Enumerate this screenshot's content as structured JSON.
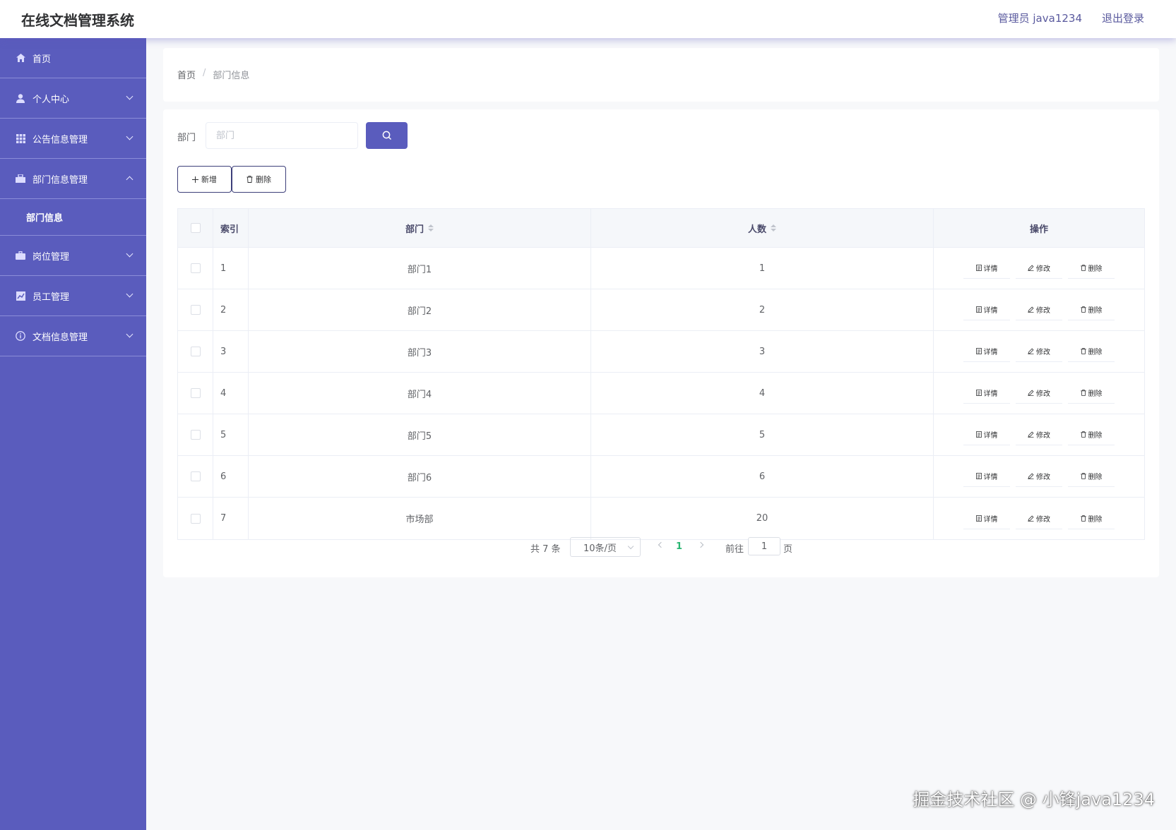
{
  "header": {
    "title": "在线文档管理系统",
    "user": "管理员 java1234",
    "logout": "退出登录"
  },
  "sidebar": {
    "items": [
      {
        "label": "首页",
        "icon": "home-icon"
      },
      {
        "label": "个人中心",
        "icon": "user-icon"
      },
      {
        "label": "公告信息管理",
        "icon": "grid-icon"
      },
      {
        "label": "部门信息管理",
        "icon": "briefcase-icon"
      },
      {
        "label": "岗位管理",
        "icon": "suitcase-icon"
      },
      {
        "label": "员工管理",
        "icon": "chart-icon"
      },
      {
        "label": "文档信息管理",
        "icon": "info-icon"
      }
    ],
    "submenu": {
      "label": "部门信息"
    }
  },
  "breadcrumb": {
    "home": "首页",
    "separator": "/",
    "current": "部门信息"
  },
  "search": {
    "label": "部门",
    "placeholder": "部门",
    "value": ""
  },
  "toolbar": {
    "add_label": "新增",
    "delete_label": "删除"
  },
  "table": {
    "headers": {
      "index": "索引",
      "department": "部门",
      "count": "人数",
      "actions": "操作"
    },
    "rows": [
      {
        "index": "1",
        "department": "部门1",
        "count": "1"
      },
      {
        "index": "2",
        "department": "部门2",
        "count": "2"
      },
      {
        "index": "3",
        "department": "部门3",
        "count": "3"
      },
      {
        "index": "4",
        "department": "部门4",
        "count": "4"
      },
      {
        "index": "5",
        "department": "部门5",
        "count": "5"
      },
      {
        "index": "6",
        "department": "部门6",
        "count": "6"
      },
      {
        "index": "7",
        "department": "市场部",
        "count": "20"
      }
    ],
    "actions": {
      "detail": "详情",
      "edit": "修改",
      "delete": "删除"
    }
  },
  "pagination": {
    "total": "共 7 条",
    "page_size": "10条/页",
    "current_page": "1",
    "goto_label": "前往",
    "goto_value": "1",
    "page_suffix": "页"
  },
  "watermark": "掘金技术社区 @ 小锋java1234",
  "colors": {
    "accent": "#5a5cbd",
    "active_page": "#2bb673"
  }
}
